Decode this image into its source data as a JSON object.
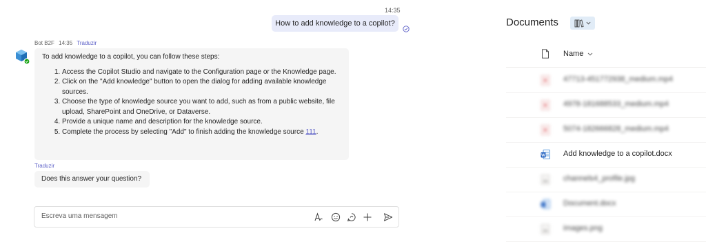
{
  "chat": {
    "outgoing": {
      "time": "14:35",
      "text": "How to add knowledge to a copilot?"
    },
    "bot": {
      "name": "Bot B2F",
      "time": "14:35",
      "translate_label": "Traduzir",
      "intro": "To add knowledge to a copilot, you can follow these steps:",
      "steps": [
        "Access the Copilot Studio and navigate to the Configuration page or the Knowledge page.",
        "Click on the \"Add knowledge\" button to open the dialog for adding available knowledge sources.",
        "Choose the type of knowledge source you want to add, such as from a public website, file upload, SharePoint and OneDrive, or Dataverse.",
        "Provide a unique name and description for the knowledge source."
      ],
      "last_step": "Complete the process by selecting \"Add\" to finish adding the knowledge source",
      "citation": "111",
      "translate_label_2": "Traduzir",
      "followup": "Does this answer your question?"
    },
    "composer": {
      "placeholder": "Escreva uma mensagem"
    }
  },
  "documents": {
    "title": "Documents",
    "column_name": "Name",
    "files": [
      {
        "name": "47713-451772938_medium.mp4",
        "type": "video",
        "blurred": true
      },
      {
        "name": "4978-181688533_medium.mp4",
        "type": "video",
        "blurred": true
      },
      {
        "name": "5074-182666828_medium.mp4",
        "type": "video",
        "blurred": true
      },
      {
        "name": "Add knowledge to a copilot.docx",
        "type": "word",
        "blurred": false
      },
      {
        "name": "channels4_profile.jpg",
        "type": "image",
        "blurred": true
      },
      {
        "name": "Document.docx",
        "type": "word",
        "blurred": true
      },
      {
        "name": "images.png",
        "type": "image",
        "blurred": true
      }
    ]
  },
  "colors": {
    "accent": "#5b5fc7",
    "outgoing_bubble": "#e8ebfa",
    "incoming_bubble": "#f5f5f5",
    "word_blue": "#185abd",
    "video_red": "#d13438"
  }
}
